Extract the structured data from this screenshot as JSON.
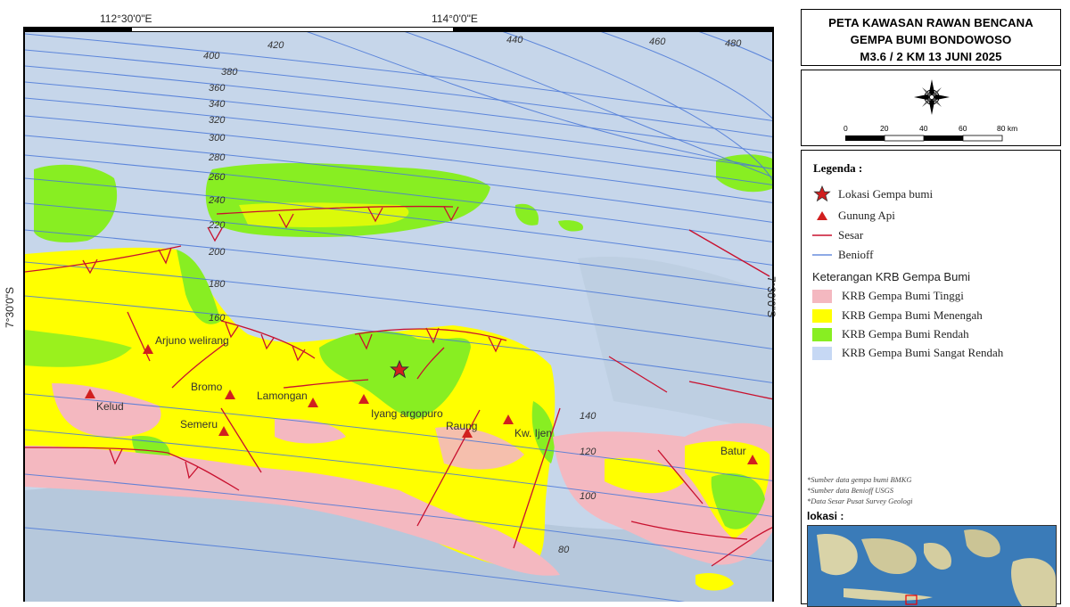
{
  "title": {
    "line1": "PETA KAWASAN RAWAN BENCANA",
    "line2": "GEMPA BUMI BONDOWOSO",
    "line3": "M3.6 / 2 KM 13 JUNI 2025"
  },
  "coordinates": {
    "top_left": "112°30'0\"E",
    "top_right": "114°0'0\"E",
    "left": "7°30'0\"S",
    "right": "7°30'0\"S"
  },
  "scale_bar": {
    "ticks": [
      "0",
      "20",
      "40",
      "60",
      "80 km"
    ]
  },
  "legend": {
    "title": "Legenda :",
    "items": [
      {
        "label": "Lokasi Gempa bumi",
        "symbol": "star-icon"
      },
      {
        "label": "Gunung Api",
        "symbol": "volcano-triangle-icon"
      },
      {
        "label": "Sesar",
        "symbol": "fault-line"
      },
      {
        "label": "Benioff",
        "symbol": "benioff-line"
      }
    ],
    "krb_title": "Keterangan KRB Gempa Bumi",
    "krb_items": [
      {
        "label": "KRB Gempa Bumi Tinggi",
        "color": "#f4b8c0"
      },
      {
        "label": "KRB Gempa Bumi Menengah",
        "color": "#ffff00"
      },
      {
        "label": "KRB Gempa Bumi Rendah",
        "color": "#88ee22"
      },
      {
        "label": "KRB Gempa Bumi Sangat Rendah",
        "color": "#c6d8f4"
      }
    ]
  },
  "sources": [
    "*Sumber data gempa bumi BMKG",
    "*Sumber data Benioff USGS",
    "*Data Sesar Pusat Survey Geologi"
  ],
  "lokasi_label": "lokasi :",
  "volcanoes": [
    {
      "name": "Arjuno welirang"
    },
    {
      "name": "Kelud"
    },
    {
      "name": "Bromo"
    },
    {
      "name": "Lamongan"
    },
    {
      "name": "Iyang argopuro"
    },
    {
      "name": "Semeru"
    },
    {
      "name": "Raung"
    },
    {
      "name": "Kw. Ijen"
    },
    {
      "name": "Batur"
    }
  ],
  "benioff_labels": [
    "400",
    "380",
    "360",
    "340",
    "320",
    "300",
    "280",
    "260",
    "240",
    "220",
    "200",
    "180",
    "160",
    "140",
    "120",
    "100",
    "80",
    "420",
    "440",
    "460",
    "480"
  ],
  "colors": {
    "zone_high": "#f4b8c0",
    "zone_medium": "#ffff00",
    "zone_low": "#88ee22",
    "zone_very_low": "#c6d8f4",
    "fault": "#c8102e",
    "benioff": "#4a78d8",
    "volcano": "#d11f1f",
    "sea": "#c9d9ec"
  }
}
